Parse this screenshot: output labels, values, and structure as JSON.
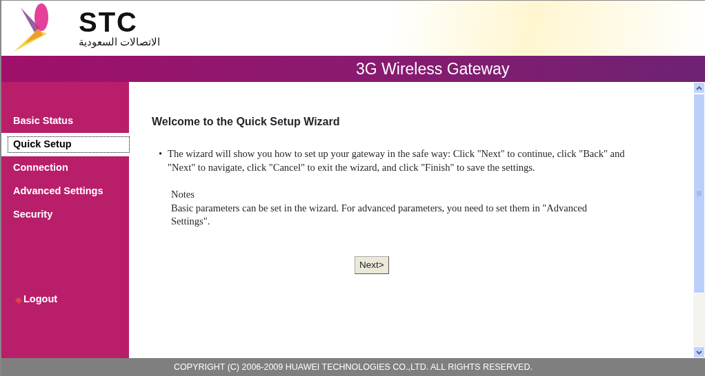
{
  "header": {
    "logo_text": "STC",
    "logo_subtitle": "الاتصالات السعودية",
    "banner_title": "3G Wireless Gateway"
  },
  "sidebar": {
    "items": [
      {
        "label": "Basic Status",
        "selected": false
      },
      {
        "label": "Quick Setup",
        "selected": true
      },
      {
        "label": "Connection",
        "selected": false
      },
      {
        "label": "Advanced Settings",
        "selected": false
      },
      {
        "label": "Security",
        "selected": false
      }
    ],
    "logout": "Logout"
  },
  "content": {
    "title": "Welcome to the Quick Setup Wizard",
    "bullet_marker": "•",
    "bullets": [
      "The wizard will show you how to set up your gateway in the safe way: Click \"Next\" to continue, click \"Back\" and \"Next\" to navigate, click \"Cancel\" to exit the wizard, and click \"Finish\" to save the settings."
    ],
    "notes_label": "Notes",
    "notes_text": "Basic parameters can be set in the wizard. For advanced parameters, you need to set them in \"Advanced Settings\".",
    "next_button": "Next>"
  },
  "footer": "COPYRIGHT (C) 2006-2009 HUAWEI TECHNOLOGIES CO.,LTD. ALL RIGHTS RESERVED."
}
